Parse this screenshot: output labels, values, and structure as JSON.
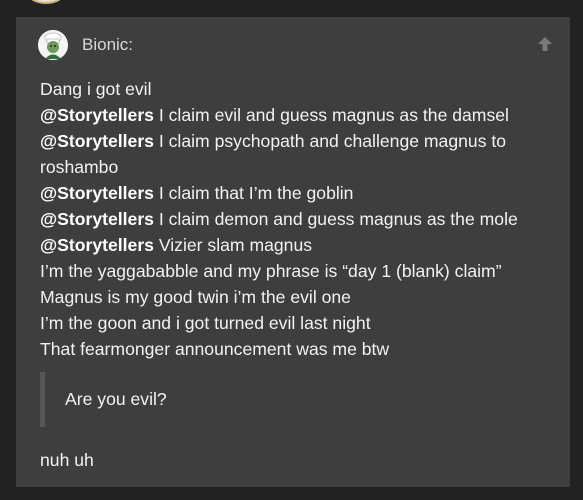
{
  "quote": {
    "username": "Bionic:",
    "avatar_icon": "chef-avatar-icon",
    "jump_icon": "arrow-up-icon",
    "lines": [
      {
        "mention": "",
        "text": "Dang i got evil"
      },
      {
        "mention": "@Storytellers",
        "text": " I claim evil and guess magnus as the damsel"
      },
      {
        "mention": "@Storytellers",
        "text": " I claim psychopath and challenge magnus to roshambo"
      },
      {
        "mention": "@Storytellers",
        "text": " I claim that I’m the goblin"
      },
      {
        "mention": "@Storytellers",
        "text": " I claim demon and guess magnus as the mole"
      },
      {
        "mention": "@Storytellers",
        "text": " Vizier slam magnus"
      },
      {
        "mention": "",
        "text": "I’m the yaggababble and my phrase is “day 1 (blank) claim”"
      },
      {
        "mention": "",
        "text": "Magnus is my good twin i’m the evil one"
      },
      {
        "mention": "",
        "text": "I’m the goon and i got turned evil last night"
      },
      {
        "mention": "",
        "text": "That fearmonger announcement was me btw"
      }
    ]
  },
  "inner_quote": {
    "text": "Are you evil?"
  },
  "reply": {
    "text": "nuh uh"
  },
  "colors": {
    "page_bg": "#222222",
    "card_bg": "#3e3e3e",
    "text": "#f2f2f2",
    "muted": "#d8d8d8",
    "quote_border": "#575757"
  }
}
